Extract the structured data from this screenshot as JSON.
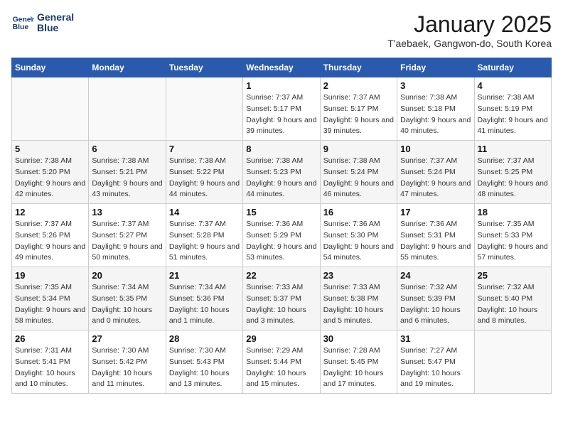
{
  "logo": {
    "line1": "General",
    "line2": "Blue"
  },
  "title": "January 2025",
  "subtitle": "T'aebaek, Gangwon-do, South Korea",
  "weekdays": [
    "Sunday",
    "Monday",
    "Tuesday",
    "Wednesday",
    "Thursday",
    "Friday",
    "Saturday"
  ],
  "weeks": [
    [
      {
        "day": null
      },
      {
        "day": null
      },
      {
        "day": null
      },
      {
        "day": "1",
        "sunrise": "7:37 AM",
        "sunset": "5:17 PM",
        "daylight": "9 hours and 39 minutes."
      },
      {
        "day": "2",
        "sunrise": "7:37 AM",
        "sunset": "5:17 PM",
        "daylight": "9 hours and 39 minutes."
      },
      {
        "day": "3",
        "sunrise": "7:38 AM",
        "sunset": "5:18 PM",
        "daylight": "9 hours and 40 minutes."
      },
      {
        "day": "4",
        "sunrise": "7:38 AM",
        "sunset": "5:19 PM",
        "daylight": "9 hours and 41 minutes."
      }
    ],
    [
      {
        "day": "5",
        "sunrise": "7:38 AM",
        "sunset": "5:20 PM",
        "daylight": "9 hours and 42 minutes."
      },
      {
        "day": "6",
        "sunrise": "7:38 AM",
        "sunset": "5:21 PM",
        "daylight": "9 hours and 43 minutes."
      },
      {
        "day": "7",
        "sunrise": "7:38 AM",
        "sunset": "5:22 PM",
        "daylight": "9 hours and 44 minutes."
      },
      {
        "day": "8",
        "sunrise": "7:38 AM",
        "sunset": "5:23 PM",
        "daylight": "9 hours and 44 minutes."
      },
      {
        "day": "9",
        "sunrise": "7:38 AM",
        "sunset": "5:24 PM",
        "daylight": "9 hours and 46 minutes."
      },
      {
        "day": "10",
        "sunrise": "7:37 AM",
        "sunset": "5:24 PM",
        "daylight": "9 hours and 47 minutes."
      },
      {
        "day": "11",
        "sunrise": "7:37 AM",
        "sunset": "5:25 PM",
        "daylight": "9 hours and 48 minutes."
      }
    ],
    [
      {
        "day": "12",
        "sunrise": "7:37 AM",
        "sunset": "5:26 PM",
        "daylight": "9 hours and 49 minutes."
      },
      {
        "day": "13",
        "sunrise": "7:37 AM",
        "sunset": "5:27 PM",
        "daylight": "9 hours and 50 minutes."
      },
      {
        "day": "14",
        "sunrise": "7:37 AM",
        "sunset": "5:28 PM",
        "daylight": "9 hours and 51 minutes."
      },
      {
        "day": "15",
        "sunrise": "7:36 AM",
        "sunset": "5:29 PM",
        "daylight": "9 hours and 53 minutes."
      },
      {
        "day": "16",
        "sunrise": "7:36 AM",
        "sunset": "5:30 PM",
        "daylight": "9 hours and 54 minutes."
      },
      {
        "day": "17",
        "sunrise": "7:36 AM",
        "sunset": "5:31 PM",
        "daylight": "9 hours and 55 minutes."
      },
      {
        "day": "18",
        "sunrise": "7:35 AM",
        "sunset": "5:33 PM",
        "daylight": "9 hours and 57 minutes."
      }
    ],
    [
      {
        "day": "19",
        "sunrise": "7:35 AM",
        "sunset": "5:34 PM",
        "daylight": "9 hours and 58 minutes."
      },
      {
        "day": "20",
        "sunrise": "7:34 AM",
        "sunset": "5:35 PM",
        "daylight": "10 hours and 0 minutes."
      },
      {
        "day": "21",
        "sunrise": "7:34 AM",
        "sunset": "5:36 PM",
        "daylight": "10 hours and 1 minute."
      },
      {
        "day": "22",
        "sunrise": "7:33 AM",
        "sunset": "5:37 PM",
        "daylight": "10 hours and 3 minutes."
      },
      {
        "day": "23",
        "sunrise": "7:33 AM",
        "sunset": "5:38 PM",
        "daylight": "10 hours and 5 minutes."
      },
      {
        "day": "24",
        "sunrise": "7:32 AM",
        "sunset": "5:39 PM",
        "daylight": "10 hours and 6 minutes."
      },
      {
        "day": "25",
        "sunrise": "7:32 AM",
        "sunset": "5:40 PM",
        "daylight": "10 hours and 8 minutes."
      }
    ],
    [
      {
        "day": "26",
        "sunrise": "7:31 AM",
        "sunset": "5:41 PM",
        "daylight": "10 hours and 10 minutes."
      },
      {
        "day": "27",
        "sunrise": "7:30 AM",
        "sunset": "5:42 PM",
        "daylight": "10 hours and 11 minutes."
      },
      {
        "day": "28",
        "sunrise": "7:30 AM",
        "sunset": "5:43 PM",
        "daylight": "10 hours and 13 minutes."
      },
      {
        "day": "29",
        "sunrise": "7:29 AM",
        "sunset": "5:44 PM",
        "daylight": "10 hours and 15 minutes."
      },
      {
        "day": "30",
        "sunrise": "7:28 AM",
        "sunset": "5:45 PM",
        "daylight": "10 hours and 17 minutes."
      },
      {
        "day": "31",
        "sunrise": "7:27 AM",
        "sunset": "5:47 PM",
        "daylight": "10 hours and 19 minutes."
      },
      {
        "day": null
      }
    ]
  ]
}
